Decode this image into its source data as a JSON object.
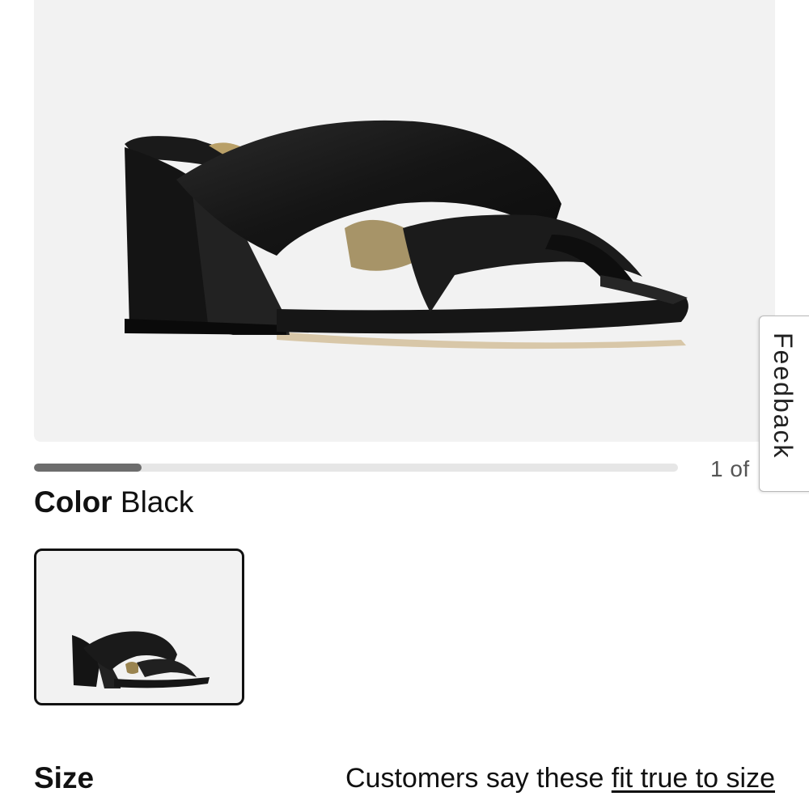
{
  "product": {
    "image_icon": "black-leather-block-heel-slide-sandal",
    "gallery_progress": 0.1667,
    "gallery_counter": "1 of"
  },
  "color": {
    "label": "Color",
    "value": "Black",
    "swatch_icon": "black-slide-sandal-thumbnail"
  },
  "size": {
    "title": "Size",
    "fit_prefix": "Customers say these ",
    "fit_link": "fit true to size"
  },
  "feedback": {
    "label": "Feedback"
  },
  "colors": {
    "hero_background": "#f2f2f2",
    "progress_track": "#e6e6e6",
    "progress_fill": "#6d6d6d",
    "swatch_border": "#111111"
  }
}
